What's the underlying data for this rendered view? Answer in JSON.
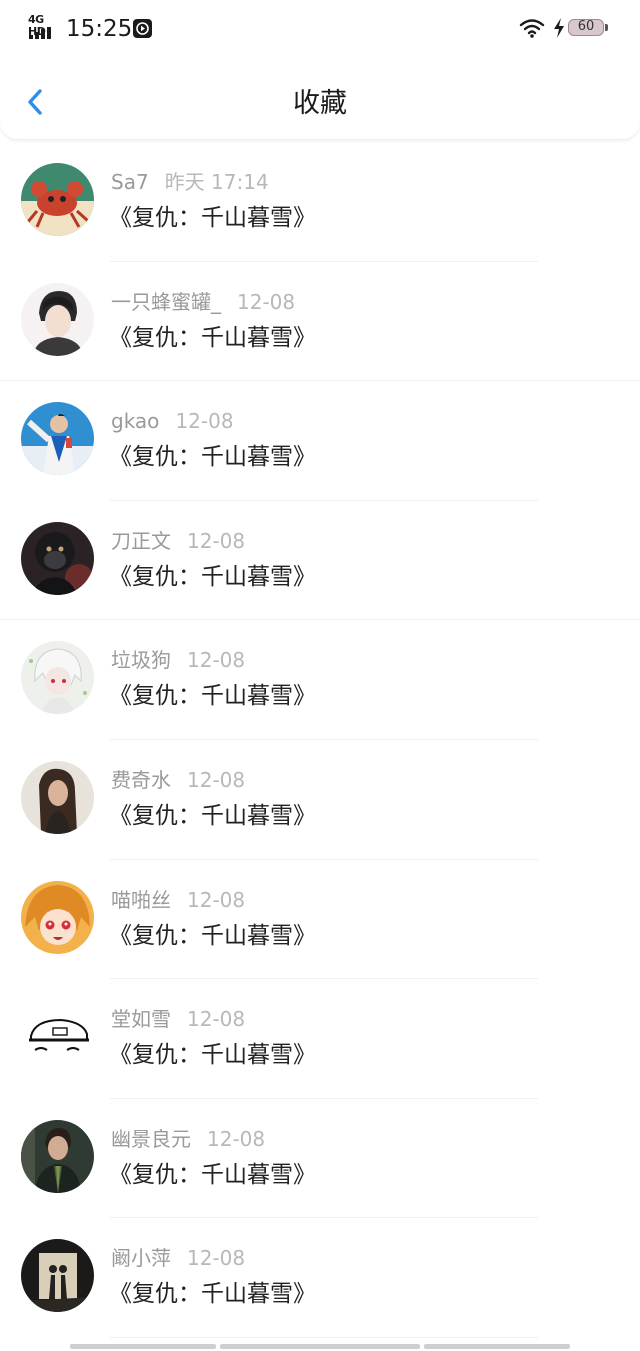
{
  "status_bar": {
    "network": "4G HD",
    "time": "15:25",
    "battery": "60"
  },
  "header": {
    "title": "收藏",
    "back_icon": "chevron-left-icon"
  },
  "accent_color": "#2d8cf0",
  "items": [
    {
      "user": "Sa7",
      "time": "昨天 17:14",
      "title": "《复仇：千山暮雪》",
      "avatar": "crab-avatar"
    },
    {
      "user": "一只蜂蜜罐_",
      "time": "12-08",
      "title": "《复仇：千山暮雪》",
      "avatar": "boy-portrait-avatar"
    },
    {
      "user": "gkao",
      "time": "12-08",
      "title": "《复仇：千山暮雪》",
      "avatar": "athlete-avatar"
    },
    {
      "user": "刀正文",
      "time": "12-08",
      "title": "《复仇：千山暮雪》",
      "avatar": "gorilla-avatar"
    },
    {
      "user": "垃圾狗",
      "time": "12-08",
      "title": "《复仇：千山暮雪》",
      "avatar": "anime-white-hair-avatar"
    },
    {
      "user": "费奇水",
      "time": "12-08",
      "title": "《复仇：千山暮雪》",
      "avatar": "woman-portrait-avatar"
    },
    {
      "user": "喵啪丝",
      "time": "12-08",
      "title": "《复仇：千山暮雪》",
      "avatar": "anime-orange-hair-avatar"
    },
    {
      "user": "堂如雪",
      "time": "12-08",
      "title": "《复仇：千山暮雪》",
      "avatar": "sketch-cap-avatar"
    },
    {
      "user": "幽景良元",
      "time": "12-08",
      "title": "《复仇：千山暮雪》",
      "avatar": "man-suit-avatar"
    },
    {
      "user": "阚小萍",
      "time": "12-08",
      "title": "《复仇：千山暮雪》",
      "avatar": "couple-silhouette-avatar"
    }
  ]
}
